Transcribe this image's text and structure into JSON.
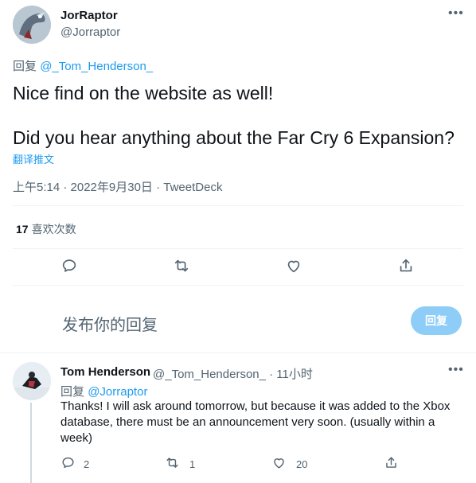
{
  "main_tweet": {
    "author_name": "JorRaptor",
    "author_handle": "@Jorraptor",
    "reply_prefix": "回复",
    "reply_mention": "@_Tom_Henderson_",
    "text_line1": "Nice find on the website as well!",
    "text_line2": "Did you hear anything about the Far Cry 6 Expansion?",
    "translate_label": "翻译推文",
    "meta": "上午5:14 · 2022年9月30日 · TweetDeck",
    "likes_count": "17",
    "likes_label": "喜欢次数"
  },
  "actions": {
    "icons": [
      "reply-icon",
      "retweet-icon",
      "like-icon",
      "share-icon"
    ]
  },
  "compose": {
    "placeholder": "发布你的回复",
    "reply_button": "回复"
  },
  "reply_tweet": {
    "author_name": "Tom Henderson",
    "author_handle": "@_Tom_Henderson_ · 11小时",
    "reply_prefix": "回复",
    "reply_mention": "@Jorraptor",
    "text": "Thanks! I will ask around tomorrow, but because it was added to the Xbox database, there must be an announcement very soon. (usually within a week)",
    "reply_count": "2",
    "retweet_count": "1",
    "like_count": "20"
  },
  "colors": {
    "accent": "#1d9bf0",
    "muted": "#536471",
    "reply_button_bg": "#8ecdf8"
  }
}
